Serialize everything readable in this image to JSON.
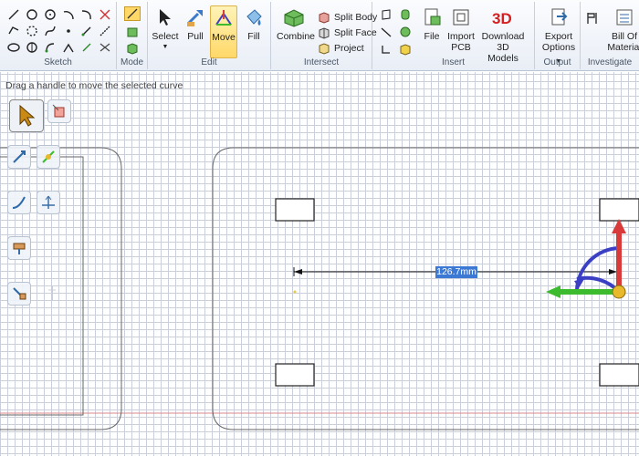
{
  "ribbon": {
    "groups": {
      "sketch": "Sketch",
      "mode": "Mode",
      "edit": "Edit",
      "intersect": "Intersect",
      "insert": "Insert",
      "output": "Output",
      "investigate": "Investigate"
    },
    "edit": {
      "select": "Select",
      "pull": "Pull",
      "move": "Move",
      "fill": "Fill"
    },
    "intersect": {
      "combine": "Combine",
      "split_body": "Split Body",
      "split_face": "Split Face",
      "project": "Project"
    },
    "insert": {
      "file": "File",
      "import_pcb_1": "Import",
      "import_pcb_2": "PCB",
      "download_1": "Download 3D",
      "download_2": "Models"
    },
    "output": {
      "export_1": "Export",
      "export_2": "Options"
    },
    "investigate": {
      "bom_1": "Bill Of",
      "bom_2": "Material"
    }
  },
  "canvas": {
    "hint": "Drag a handle to move the selected curve",
    "dimension_value": "126.7mm"
  },
  "colors": {
    "ribbon_bg": "#eef2f8",
    "grid": "#c9cfdb",
    "axis_red": "#d93a3a",
    "axis_green": "#3dbb2e",
    "axis_blue": "#3a3fc4",
    "handle": "#e8b92c",
    "selection": "#3b79d4"
  }
}
